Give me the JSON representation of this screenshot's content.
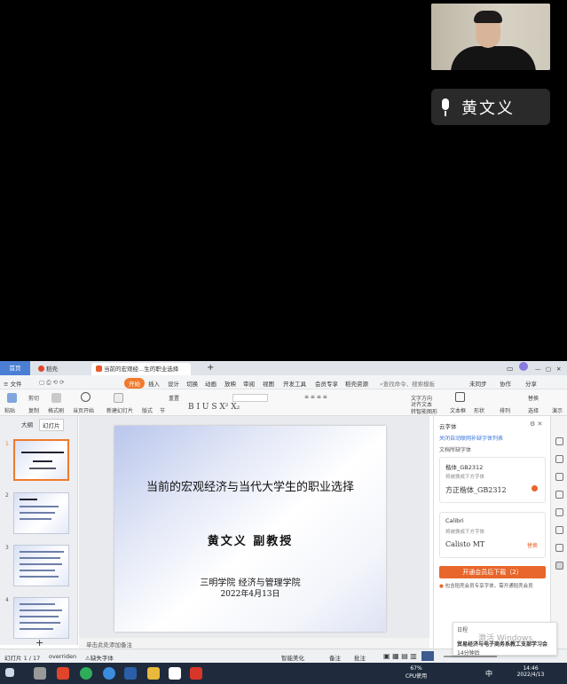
{
  "speaker": {
    "name": "黄文义"
  },
  "tabs": {
    "home": "首页",
    "daoke": "稻壳",
    "doc": "当前的宏观经...生的职业选择"
  },
  "menu": [
    "开始",
    "插入",
    "设计",
    "切换",
    "动画",
    "放映",
    "审阅",
    "视图",
    "开发工具",
    "会员专享",
    "稻壳资源"
  ],
  "menu_file": "文件",
  "search_placeholder": "查找命令、搜索模板",
  "sync": "未同步",
  "collab": "协作",
  "share": "分享",
  "ribbon": {
    "paste": "粘贴",
    "cut": "剪切",
    "copy": "复制",
    "format_painter": "格式刷",
    "from_start": "当页开始",
    "new_slide": "新建幻灯片",
    "layout": "版式",
    "section": "节",
    "reset": "重置",
    "text_dir": "文字方向",
    "align": "对齐文本",
    "convert": "转智能图形",
    "textbox": "文本框",
    "shape": "形状",
    "arrange": "排列",
    "replace": "替换",
    "select": "选择",
    "play": "演示"
  },
  "left_tabs": {
    "outline": "大纲",
    "slides": "幻灯片"
  },
  "thumbs": [
    "1",
    "2",
    "3",
    "4"
  ],
  "slide": {
    "title": "当前的宏观经济与当代大学生的职业选择",
    "author": "黄文义  副教授",
    "school": "三明学院 经济与管理学院",
    "date": "2022年4月13日"
  },
  "notes": "单击此处添加备注",
  "panel": {
    "title": "云字体",
    "link": "关闭自动联网补缺字体列表",
    "section": "文档所缺字体",
    "font1": {
      "name": "楷体_GB2312",
      "hint": "将被换成下方字体",
      "replace": "方正楷体_GB2312"
    },
    "font2": {
      "name": "Calibri",
      "hint": "将被换成下方字体",
      "replace": "Calisto MT",
      "tag": "替换"
    },
    "button": "开通会员后下载（2）",
    "tip": "包含稻壳会员专享字体，需开通稻壳会员"
  },
  "status": {
    "slide_no": "幻灯片 1 / 17",
    "theme": "overriden",
    "missing": "缺失字体",
    "smart": "智能美化",
    "notes": "备注",
    "comment": "批注"
  },
  "notification": {
    "app": "日程",
    "title": "贸易经济与电子商务系教工支部学习会",
    "time": "14分钟后",
    "watermark": "激活 Windows"
  },
  "taskbar": {
    "cpu_pct": "67%",
    "cpu_label": "CPU使用",
    "ime": "中",
    "time": "14:46",
    "date": "2022/4/13"
  }
}
